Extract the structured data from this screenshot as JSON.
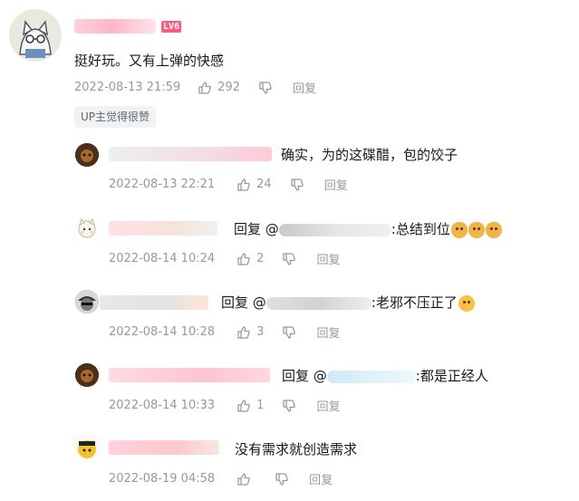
{
  "main_comment": {
    "level_badge": "LV6",
    "text": "挺好玩。又有上弹的快感",
    "time": "2022-08-13 21:59",
    "likes": "292",
    "reply_label": "回复",
    "up_tag": "UP主觉得很赞"
  },
  "replies": [
    {
      "text": "确实，为的这碟醋，包的饺子",
      "time": "2022-08-13 22:21",
      "likes": "24",
      "reply_label": "回复"
    },
    {
      "reply_prefix": "回复 @",
      "text": ":总结到位",
      "time": "2022-08-14 10:24",
      "likes": "2",
      "reply_label": "回复"
    },
    {
      "reply_prefix": "回复 @",
      "text": ":老邪不压正了",
      "time": "2022-08-14 10:28",
      "likes": "3",
      "reply_label": "回复"
    },
    {
      "reply_prefix": "回复 @",
      "text": ":都是正经人",
      "time": "2022-08-14 10:33",
      "likes": "1",
      "reply_label": "回复"
    },
    {
      "text": "没有需求就创造需求",
      "time": "2022-08-19 04:58",
      "likes": "",
      "reply_label": "回复"
    }
  ],
  "colors": {
    "text": "#18191c",
    "meta": "#9499a0",
    "badge": "#ff5c7c"
  },
  "icons": {
    "like": "thumbs-up-icon",
    "dislike": "thumbs-down-icon",
    "emoji": "dog-emoji-icon",
    "smile": "smile-emoji-icon"
  }
}
